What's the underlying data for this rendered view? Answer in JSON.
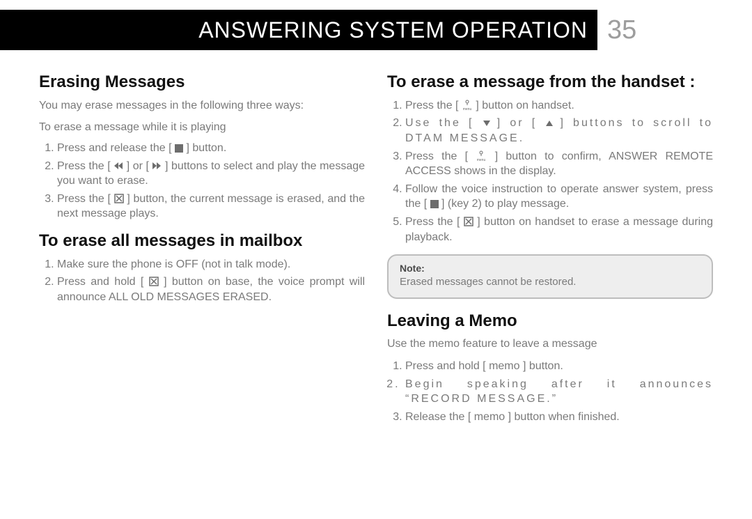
{
  "header": {
    "title": "ANSWERING SYSTEM OPERATION",
    "page_number": "35"
  },
  "left": {
    "sec1": {
      "title": "Erasing Messages",
      "intro": "You may erase messages in the following three ways:",
      "subhead": "To erase a message while it is playing",
      "step1a": "Press and release the [ ",
      "step1b": " ] button.",
      "step2a": "Press the [ ",
      "step2b": " ] or [ ",
      "step2c": " ] buttons to select and play the message you want to erase.",
      "step3a": "Press the [ ",
      "step3b": " ] button, the current message is erased, and the next message plays."
    },
    "sec2": {
      "title": "To erase all messages in mailbox",
      "step1": "Make sure the phone is OFF (not in talk mode).",
      "step2a": "Press and hold [ ",
      "step2b": " ] button on base, the voice prompt will announce ALL OLD MESSAGES ERASED."
    }
  },
  "right": {
    "sec1": {
      "title": "To erase a message from the handset :",
      "step1a": "Press the [ ",
      "step1b": " ] button on handset.",
      "step2a": "Use the [ ",
      "step2b": " ] or [ ",
      "step2c": " ] buttons to scroll to DTAM MESSAGE.",
      "step3a": "Press the [ ",
      "step3b": " ] button to confirm, ANSWER REMOTE ACCESS shows in the display.",
      "step4a": "Follow the voice instruction to operate answer system, press the [ ",
      "step4b": " ] (key 2) to play message.",
      "step5a": "Press the [ ",
      "step5b": " ] button on handset to erase a message during playback."
    },
    "note": {
      "title": "Note:",
      "text": "Erased messages cannot be restored."
    },
    "sec2": {
      "title": "Leaving a Memo",
      "intro": "Use the memo feature to leave a message",
      "step1": "Press and hold [ memo ] button.",
      "step2": "Begin speaking after it announces “RECORD MESSAGE.”",
      "step3": "Release the [ memo ] button when finished."
    }
  },
  "icons": {
    "stop": "stop-icon",
    "rew": "rewind-icon",
    "fwd": "forward-icon",
    "del": "delete-icon",
    "menu": "menu-icon",
    "down": "down-arrow-icon",
    "up": "up-arrow-icon"
  }
}
